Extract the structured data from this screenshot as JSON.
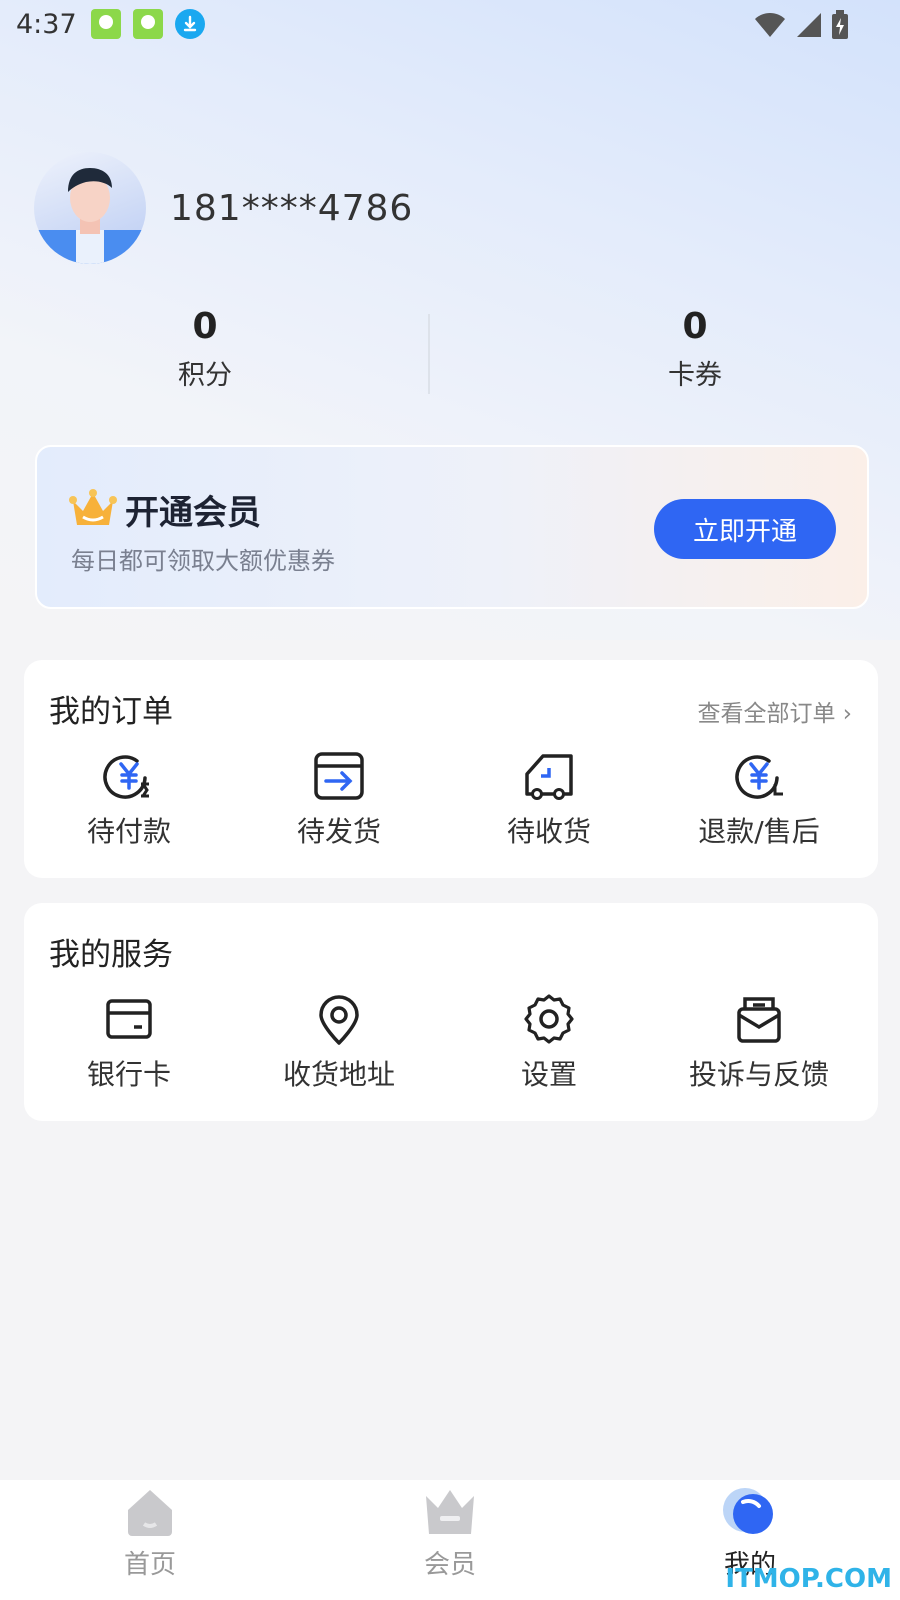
{
  "status_bar": {
    "time": "4:37"
  },
  "profile": {
    "phone": "181****4786"
  },
  "stats": [
    {
      "value": "0",
      "label": "积分"
    },
    {
      "value": "0",
      "label": "卡券"
    }
  ],
  "member_banner": {
    "title": "开通会员",
    "subtitle": "每日都可领取大额优惠券",
    "button": "立即开通"
  },
  "orders": {
    "title": "我的订单",
    "view_all": "查看全部订单",
    "items": [
      {
        "label": "待付款",
        "icon": "pending-payment-icon"
      },
      {
        "label": "待发货",
        "icon": "pending-shipment-icon"
      },
      {
        "label": "待收货",
        "icon": "pending-receipt-icon"
      },
      {
        "label": "退款/售后",
        "icon": "refund-icon"
      }
    ]
  },
  "services": {
    "title": "我的服务",
    "items": [
      {
        "label": "银行卡",
        "icon": "bank-card-icon"
      },
      {
        "label": "收货地址",
        "icon": "location-icon"
      },
      {
        "label": "设置",
        "icon": "gear-icon"
      },
      {
        "label": "投诉与反馈",
        "icon": "feedback-icon"
      }
    ]
  },
  "bottom_nav": [
    {
      "label": "首页",
      "icon": "home-icon",
      "active": false
    },
    {
      "label": "会员",
      "icon": "crown-icon",
      "active": false
    },
    {
      "label": "我的",
      "icon": "profile-icon",
      "active": true
    }
  ],
  "watermark": "ITMOP.COM",
  "colors": {
    "accent": "#2f66f3",
    "background": "#f4f4f6"
  }
}
